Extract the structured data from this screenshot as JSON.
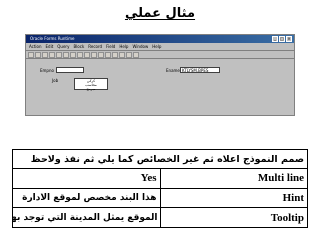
{
  "title": "مثال عملي",
  "screenshot": {
    "window_title": "Oracle Forms Runtime",
    "menu": [
      "Action",
      "Edit",
      "Query",
      "Block",
      "Record",
      "Field",
      "Help",
      "Window",
      "Help"
    ],
    "fields": {
      "left_label": "Empno",
      "left_value": "",
      "right_label": "Ename",
      "right_value": "KTLYSM.BPES",
      "list_label": "Job",
      "list_items": [
        "كركي",
        "محاسب",
        "مبرمج"
      ]
    }
  },
  "table": {
    "instruction": "صمم النموذج اعلاه ثم غير الخصائص كما يلي ثم نفذ ولاحظ",
    "rows": [
      {
        "key": "Multi line",
        "value": "Yes"
      },
      {
        "key": "Hint",
        "value": "هذا البند مخصص لموقع الادارة"
      },
      {
        "key": "Tooltip",
        "value": "الموقع يمثل المدينة التي توجد بها الادارة"
      }
    ]
  }
}
